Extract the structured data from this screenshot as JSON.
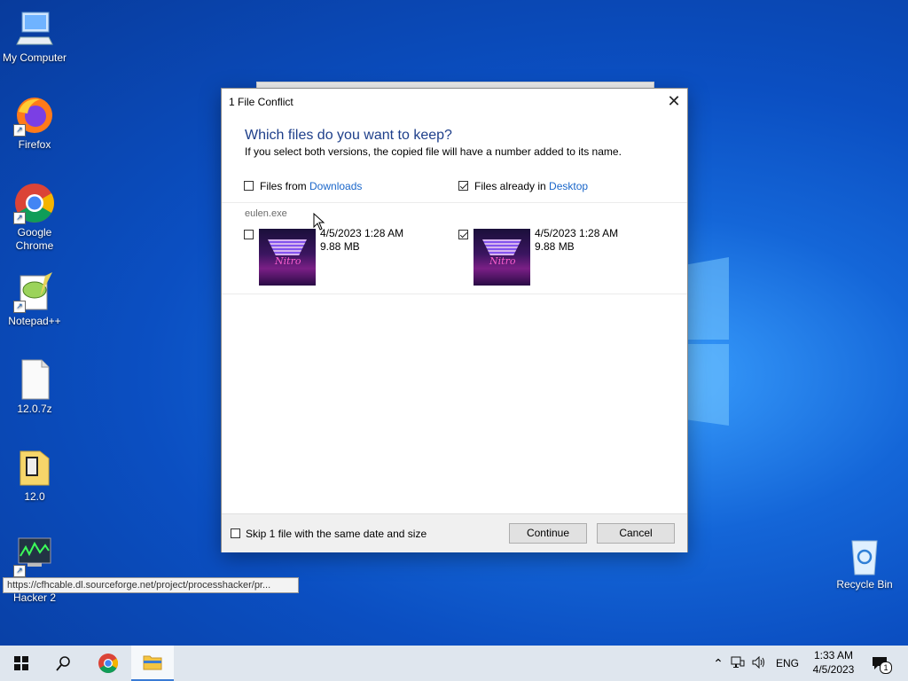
{
  "desktop": {
    "icons": [
      {
        "label": "My Computer"
      },
      {
        "label": "Firefox"
      },
      {
        "label": "Google Chrome"
      },
      {
        "label": "Notepad++"
      },
      {
        "label": "12.0.7z"
      },
      {
        "label": "12.0"
      },
      {
        "label": "Hacker 2"
      },
      {
        "label": "Recycle Bin"
      }
    ]
  },
  "dialog": {
    "title": "1 File Conflict",
    "heading": "Which files do you want to keep?",
    "subtext": "If you select both versions, the copied file will have a number added to its name.",
    "source": {
      "prefix": "Files from ",
      "link": "Downloads",
      "checked": false
    },
    "dest": {
      "prefix": "Files already in ",
      "link": "Desktop",
      "checked": true
    },
    "file_name": "eulen.exe",
    "left_file": {
      "date": "4/5/2023 1:28 AM",
      "size": "9.88 MB",
      "checked": false
    },
    "right_file": {
      "date": "4/5/2023 1:28 AM",
      "size": "9.88 MB",
      "checked": true
    },
    "skip_label": "Skip 1 file with the same date and size",
    "continue_label": "Continue",
    "cancel_label": "Cancel"
  },
  "tooltip": {
    "text": "https://cfhcable.dl.sourceforge.net/project/processhacker/pr..."
  },
  "taskbar": {
    "language": "ENG",
    "time": "1:33 AM",
    "date": "4/5/2023",
    "notification_count": "1"
  },
  "colors": {
    "accent": "#1a66c9",
    "heading": "#1e3f8a",
    "desktop": "#0b4fc2"
  }
}
